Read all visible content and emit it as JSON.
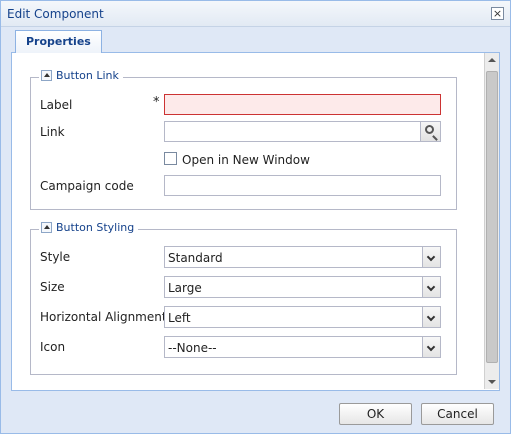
{
  "window": {
    "title": "Edit Component",
    "close_glyph": "×"
  },
  "tabs": [
    {
      "label": "Properties",
      "active": true
    }
  ],
  "button_link": {
    "legend": "Button Link",
    "label_field": {
      "label": "Label",
      "required_marker": "*",
      "value": "",
      "invalid": true
    },
    "link_field": {
      "label": "Link",
      "value": "",
      "icon": "search-icon"
    },
    "open_new_window": {
      "label": "Open in New Window",
      "checked": false
    },
    "campaign_code": {
      "label": "Campaign code",
      "value": ""
    }
  },
  "button_styling": {
    "legend": "Button Styling",
    "style": {
      "label": "Style",
      "value": "Standard"
    },
    "size": {
      "label": "Size",
      "value": "Large"
    },
    "alignment": {
      "label": "Horizontal Alignment",
      "value": "Left"
    },
    "icon": {
      "label": "Icon",
      "value": "--None--"
    }
  },
  "footer": {
    "ok_label": "OK",
    "cancel_label": "Cancel"
  },
  "colors": {
    "frame_bg": "#dfe8f6",
    "frame_border": "#99bbe8",
    "title_text": "#15428b",
    "invalid_border": "#cc3333",
    "invalid_bg": "#fdeaea"
  }
}
